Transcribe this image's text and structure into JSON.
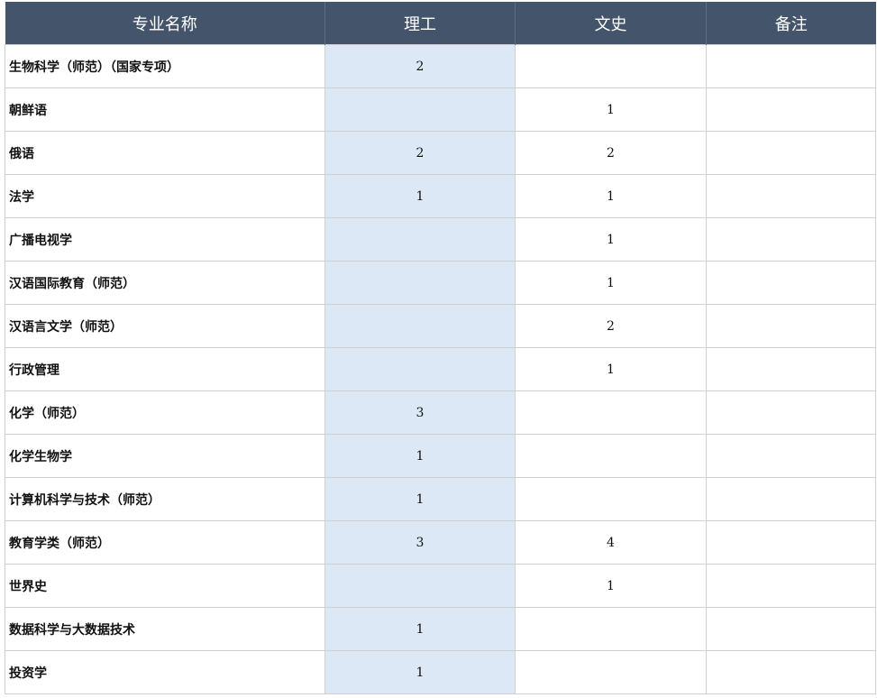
{
  "table": {
    "headers": [
      "专业名称",
      "理工",
      "文史",
      "备注"
    ],
    "rows": [
      {
        "name": "生物科学（师范）（国家专项）",
        "ligong": "2",
        "wenshi": "",
        "note": ""
      },
      {
        "name": "朝鲜语",
        "ligong": "",
        "wenshi": "1",
        "note": ""
      },
      {
        "name": "俄语",
        "ligong": "2",
        "wenshi": "2",
        "note": ""
      },
      {
        "name": "法学",
        "ligong": "1",
        "wenshi": "1",
        "note": ""
      },
      {
        "name": "广播电视学",
        "ligong": "",
        "wenshi": "1",
        "note": ""
      },
      {
        "name": "汉语国际教育（师范）",
        "ligong": "",
        "wenshi": "1",
        "note": ""
      },
      {
        "name": "汉语言文学（师范）",
        "ligong": "",
        "wenshi": "2",
        "note": ""
      },
      {
        "name": "行政管理",
        "ligong": "",
        "wenshi": "1",
        "note": ""
      },
      {
        "name": "化学（师范）",
        "ligong": "3",
        "wenshi": "",
        "note": ""
      },
      {
        "name": "化学生物学",
        "ligong": "1",
        "wenshi": "",
        "note": ""
      },
      {
        "name": "计算机科学与技术（师范）",
        "ligong": "1",
        "wenshi": "",
        "note": ""
      },
      {
        "name": "教育学类（师范）",
        "ligong": "3",
        "wenshi": "4",
        "note": ""
      },
      {
        "name": "世界史",
        "ligong": "",
        "wenshi": "1",
        "note": ""
      },
      {
        "name": "数据科学与大数据技术",
        "ligong": "1",
        "wenshi": "",
        "note": ""
      },
      {
        "name": "投资学",
        "ligong": "1",
        "wenshi": "",
        "note": ""
      }
    ]
  },
  "colors": {
    "header_bg": "#44546a",
    "ligong_column_bg": "#dce8f5",
    "grid_line": "#d0d0d0"
  }
}
